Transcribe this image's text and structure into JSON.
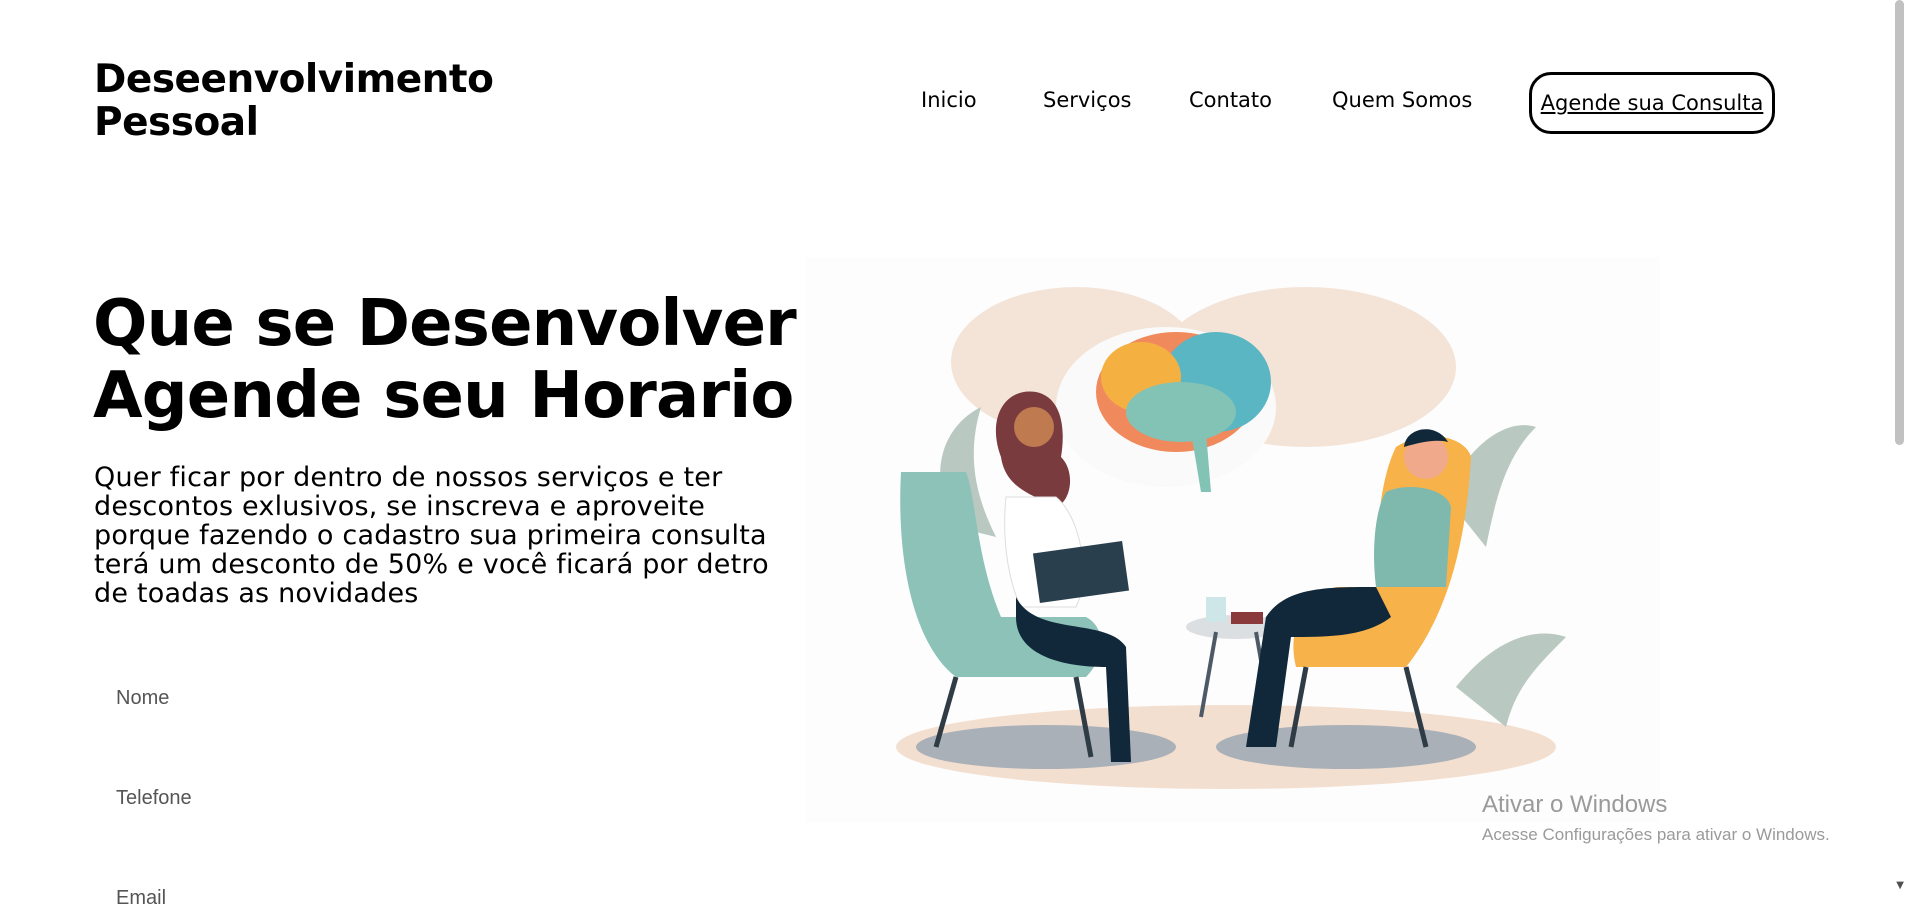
{
  "header": {
    "brand_line1": "Deseenvolvimento",
    "brand_line2": "Pessoal",
    "nav": {
      "inicio": "Inicio",
      "servicos": "Serviços",
      "contato": "Contato",
      "quem_somos": "Quem Somos"
    },
    "cta_label": "Agende sua Consulta"
  },
  "hero": {
    "title_line1": "Que se Desenvolver",
    "title_line2": "Agende seu Horario",
    "text_lines": [
      "Quer ficar por dentro de nossos serviços e ter",
      "descontos exlusivos, se inscreva e aproveite",
      "porque fazendo o cadastro sua primeira consulta",
      "terá um desconto de 50% e você ficará por detro",
      "de toadas as novidades"
    ]
  },
  "form": {
    "nome_placeholder": "Nome",
    "telefone_placeholder": "Telefone",
    "email_placeholder": "Email"
  },
  "illustration": {
    "icon": "therapy-session-illustration"
  },
  "windows_watermark": {
    "title": "Ativar o Windows",
    "subtitle": "Acesse Configurações para ativar o Windows."
  },
  "colors": {
    "text": "#000000",
    "background": "#ffffff",
    "chair_green": "#8cc2b8",
    "chair_yellow": "#f7b24a",
    "blob_peach": "#f3e2d6"
  }
}
